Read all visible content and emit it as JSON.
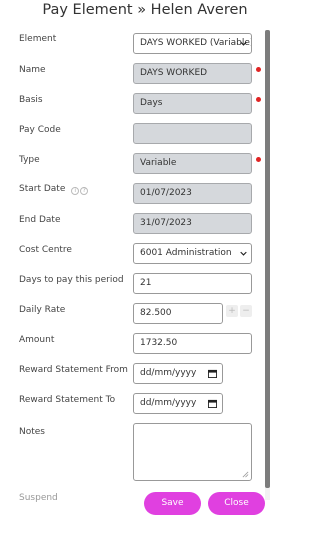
{
  "header": {
    "title": "Pay Element » Helen Averen"
  },
  "form": {
    "element": {
      "label": "Element",
      "value": "DAYS WORKED (Variable)"
    },
    "name": {
      "label": "Name",
      "value": "DAYS WORKED"
    },
    "basis": {
      "label": "Basis",
      "value": "Days"
    },
    "pay_code": {
      "label": "Pay Code",
      "value": ""
    },
    "type": {
      "label": "Type",
      "value": "Variable"
    },
    "start_date": {
      "label": "Start Date",
      "value": "01/07/2023"
    },
    "end_date": {
      "label": "End Date",
      "value": "31/07/2023"
    },
    "cost_centre": {
      "label": "Cost Centre",
      "value": "6001 Administration"
    },
    "days_to_pay": {
      "label": "Days to pay this period",
      "value": "21"
    },
    "daily_rate": {
      "label": "Daily Rate",
      "value": "82.500",
      "plus": "+",
      "minus": "−"
    },
    "amount": {
      "label": "Amount",
      "value": "1732.50"
    },
    "reward_from": {
      "label": "Reward Statement From",
      "value": "dd/mm/yyyy"
    },
    "reward_to": {
      "label": "Reward Statement To",
      "value": "dd/mm/yyyy"
    },
    "notes": {
      "label": "Notes",
      "value": ""
    },
    "suspend": {
      "label": "Suspend"
    }
  },
  "buttons": {
    "save": "Save",
    "close": "Close"
  },
  "colors": {
    "accent": "#e040e0",
    "required": "#e02424",
    "readonly_bg": "#d5d8dc"
  },
  "icons": [
    "chevron-down-icon",
    "calendar-icon",
    "info-icon",
    "help-icon",
    "resize-handle-icon"
  ]
}
